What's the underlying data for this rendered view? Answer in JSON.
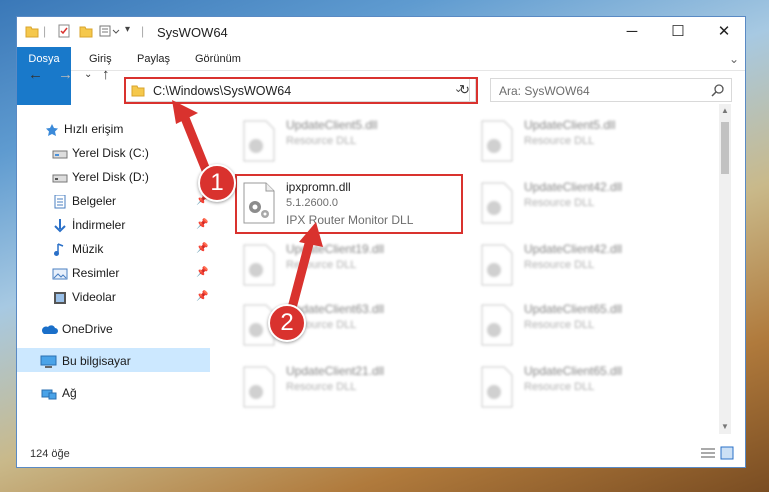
{
  "window": {
    "title": "SysWOW64",
    "controls": {
      "minimize": "─",
      "maximize": "☐",
      "close": "✕"
    }
  },
  "ribbon": {
    "tabs": [
      "Dosya",
      "Giriş",
      "Paylaş",
      "Görünüm"
    ]
  },
  "address_bar": {
    "path": "C:\\Windows\\SysWOW64"
  },
  "search": {
    "placeholder": "Ara: SysWOW64"
  },
  "sidebar": {
    "items": [
      {
        "label": "Hızlı erişim",
        "icon": "star-icon",
        "pinned": false
      },
      {
        "label": "Yerel Disk (C:)",
        "icon": "drive-icon",
        "pinned": false
      },
      {
        "label": "Yerel Disk (D:)",
        "icon": "drive-icon",
        "pinned": false
      },
      {
        "label": "Belgeler",
        "icon": "documents-icon",
        "pinned": true
      },
      {
        "label": "İndirmeler",
        "icon": "download-icon",
        "pinned": true
      },
      {
        "label": "Müzik",
        "icon": "music-icon",
        "pinned": true
      },
      {
        "label": "Resimler",
        "icon": "pictures-icon",
        "pinned": true
      },
      {
        "label": "Videolar",
        "icon": "videos-icon",
        "pinned": true
      },
      {
        "label": "OneDrive",
        "icon": "cloud-icon",
        "pinned": false
      },
      {
        "label": "Bu bilgisayar",
        "icon": "computer-icon",
        "pinned": false,
        "selected": true
      },
      {
        "label": "Ağ",
        "icon": "network-icon",
        "pinned": false
      }
    ]
  },
  "files": {
    "highlighted": {
      "name": "ipxpromn.dll",
      "version": "5.1.2600.0",
      "description": "IPX Router Monitor DLL"
    },
    "background": [
      {
        "name": "UpdateClient5.dll",
        "desc": "Resource DLL"
      },
      {
        "name": "UpdateClient5.dll",
        "desc": "Resource DLL"
      },
      {
        "name": "UpdateClient42.dll",
        "desc": "Resource DLL"
      },
      {
        "name": "UpdateClient19.dll",
        "desc": "Resource DLL"
      },
      {
        "name": "UpdateClient42.dll",
        "desc": "Resource DLL"
      },
      {
        "name": "UpdateClient63.dll",
        "desc": "Resource DLL"
      },
      {
        "name": "UpdateClient65.dll",
        "desc": "Resource DLL"
      },
      {
        "name": "UpdateClient21.dll",
        "desc": "Resource DLL"
      },
      {
        "name": "UpdateClient65.dll",
        "desc": "Resource DLL"
      }
    ]
  },
  "status_bar": {
    "item_count": "124 öğe"
  },
  "annotations": {
    "step1": "1",
    "step2": "2",
    "color": "#d9322e"
  }
}
